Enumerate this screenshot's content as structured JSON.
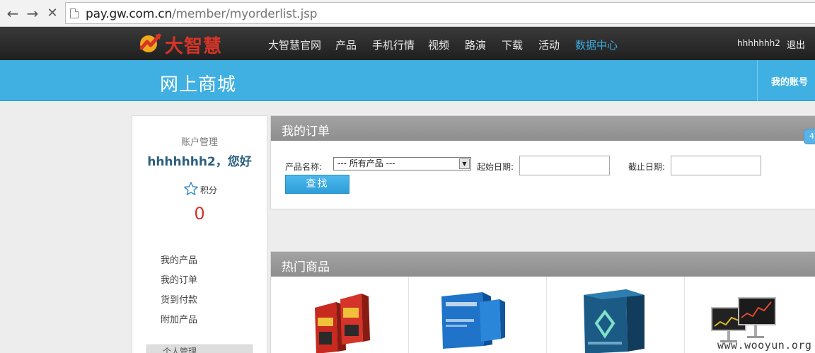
{
  "browser": {
    "back_icon": "arrow-left-icon",
    "forward_icon": "arrow-right-icon",
    "stop_icon": "close-icon",
    "url_host": "pay.gw.com.cn",
    "url_path": "/member/myorderlist.jsp"
  },
  "header": {
    "logo_text": "大智慧",
    "nav": [
      "大智慧官网",
      "产品",
      "手机行情",
      "视频",
      "路演",
      "下载",
      "活动",
      "数据中心"
    ],
    "active_nav": "数据中心",
    "username": "hhhhhhh2",
    "logout": "退出"
  },
  "banner": {
    "title": "网上商城",
    "account_link": "我的账号"
  },
  "sidebar": {
    "account_title": "账户管理",
    "greeting": "hhhhhhh2，您好",
    "points_label": "积分",
    "points_value": "0",
    "menu": [
      "我的产品",
      "我的订单",
      "货到付款",
      "附加产品"
    ],
    "sub_heading": "个人管理"
  },
  "orders": {
    "title": "我的订单",
    "product_label": "产品名称:",
    "product_select_value": "--- 所有产品 ---",
    "start_date_label": "起始日期:",
    "start_date_value": "",
    "end_date_label": "截止日期:",
    "end_date_value": "",
    "search_button": "查找",
    "side_badge": "4"
  },
  "hot": {
    "title": "热门商品"
  },
  "watermark": "www.wooyun.org",
  "colors": {
    "nav_bg": "#2b2b2b",
    "banner_blue": "#3fb0e1",
    "accent_blue": "#3aaee0",
    "points_red": "#d1342b",
    "greeting_blue": "#2c5f7e"
  }
}
